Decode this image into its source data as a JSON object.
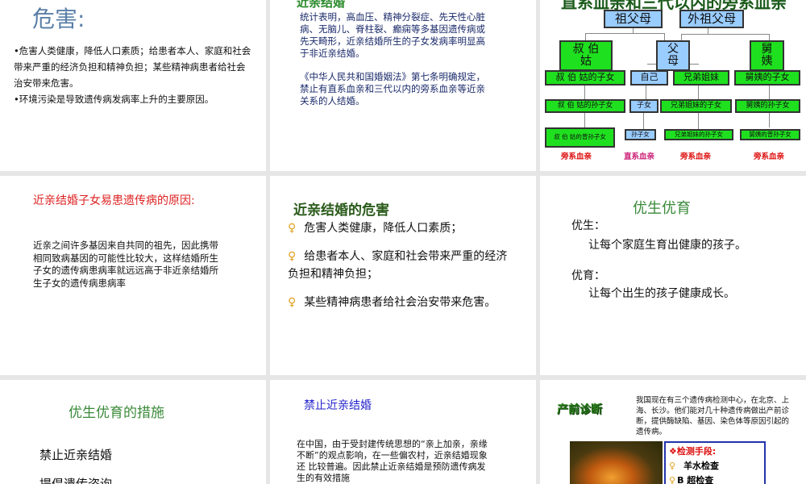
{
  "slides": {
    "harm": {
      "title": "危害:",
      "bullets": [
        "•危害人类健康，降低人口素质；给患者本人、家庭和社会带来严重的经济负担和精神负担；某些精神病患者给社会治安带来危害。",
        "•环境污染是导致遗传病发病率上升的主要原因。"
      ]
    },
    "consanguine": {
      "title": "近亲结婚",
      "para1": "统计表明，高血压、精神分裂症、先天性心脏病、无脑儿、脊柱裂、癫痫等多基因遗传病或先天畸形，近亲结婚所生的子女发病率明显高于非近亲结婚。",
      "para2": "《中华人民共和国婚姻法》第七条明确规定，禁止有直系血亲和三代以内的旁系血亲等近亲关系的人结婚。"
    },
    "tree": {
      "title": "直系血亲和三代以内的旁系血亲",
      "grandparents": "祖父母",
      "maternal_grandparents": "外祖父母",
      "uncles_aunts": "叔 伯 姑",
      "parents": "父 母",
      "maternal_uncles_aunts": "舅 姨",
      "row1": [
        "叔 伯 姑的子女",
        "自己",
        "兄弟姐妹",
        "舅姨的子女"
      ],
      "row2": [
        "叔 伯 姑的孙子女",
        "子女",
        "兄弟姐妹的子女",
        "舅姨的孙子女"
      ],
      "row3": [
        "叔 伯 姑的曾孙子女",
        "孙子女",
        "兄弟姐妹的孙子女",
        "舅姨的曾孙子女"
      ],
      "labels": [
        "旁系血亲",
        "直系血亲",
        "旁系血亲",
        "旁系血亲"
      ],
      "colors": {
        "green": "#1fe01f",
        "blue": "#99ccff",
        "collateral": "#dd1111",
        "lineal": "#cc2277"
      }
    },
    "reason": {
      "title": "近亲结婚子女易患遗传病的原因:",
      "body": "近亲之间许多基因来自共同的祖先，因此携带相同致病基因的可能性比较大，这样结婚所生子女的遗传病患病率就远远高于非近亲结婚所生子女的遗传病患病率"
    },
    "danger": {
      "title": "近亲结婚的危害",
      "bullet_icon": "♀",
      "items": [
        "危害人类健康，降低人口素质；",
        "给患者本人、家庭和社会带来严重的经济负担和精神负担；",
        "某些精神病患者给社会治安带来危害。"
      ]
    },
    "eugenics": {
      "title": "优生优育",
      "label1": "优生：",
      "text1": "让每个家庭生育出健康的孩子。",
      "label2": "优育：",
      "text2": "让每个出生的孩子健康成长。"
    },
    "measures": {
      "title": "优生优育的措施",
      "items": [
        "禁止近亲结婚",
        "提倡遗传咨询"
      ]
    },
    "ban": {
      "title": "禁止近亲结婚",
      "body": "在中国，由于受封建传统思想的“亲上加亲，亲缘不断”的观点影响，在一些偏农村，近亲结婚现象还 比较普遍。因此禁止近亲结婚是预防遗传病发生的有效措施"
    },
    "prenatal": {
      "title": "产前诊断",
      "body": "我国现在有三个遗传病检测中心，在北京、上海、长沙。他们能对几十种遗传病做出产前诊断，提供酶缺陷、基因、染色体等原因引起的遗传病。",
      "methods_title": "❖检测手段:",
      "methods": [
        "羊水检查",
        "B 超检查"
      ],
      "bullet_icon": "♀"
    }
  }
}
